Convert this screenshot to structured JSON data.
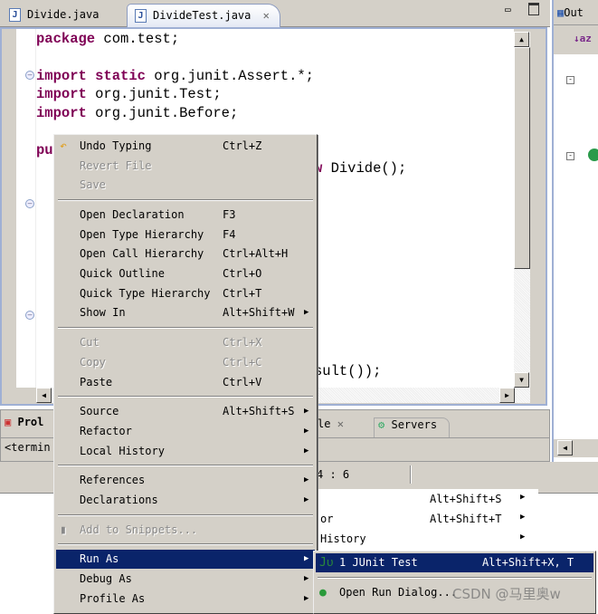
{
  "editor_tabs": [
    {
      "label": "Divide.java",
      "icon": "java-file-icon"
    },
    {
      "label": "DivideTest.java",
      "icon": "java-file-icon",
      "active": true
    }
  ],
  "code_lines": [
    [
      {
        "t": "package",
        "k": 1
      },
      {
        "t": " com.test;"
      }
    ],
    [],
    [
      {
        "t": "import",
        "k": 1
      },
      {
        "t": " "
      },
      {
        "t": "static",
        "k": 1
      },
      {
        "t": " org.junit.Assert.*;"
      }
    ],
    [
      {
        "t": "import",
        "k": 1
      },
      {
        "t": " org.junit.Test;"
      }
    ],
    [
      {
        "t": "import",
        "k": 1
      },
      {
        "t": " org.junit.Before;"
      }
    ],
    [],
    [
      {
        "t": "pu",
        "k": 1
      }
    ],
    [
      {
        "t": "                                 "
      },
      {
        "t": "w",
        "k": 1
      },
      {
        "t": " Divide();"
      }
    ]
  ],
  "code_tail": "sult());",
  "outline_tab": "Out",
  "bottom_tabs": {
    "problems": "Prol",
    "console_frag": "le",
    "servers": "Servers"
  },
  "console_text": "<termin",
  "status_position": "4 : 6",
  "ghost_menu": [
    {
      "label": "",
      "shortcut": "Alt+Shift+S"
    },
    {
      "label": "or",
      "shortcut": "Alt+Shift+T"
    },
    {
      "label": "History",
      "shortcut": ""
    }
  ],
  "context_menu": [
    {
      "label": "Undo Typing",
      "shortcut": "Ctrl+Z",
      "icon": "undo-icon"
    },
    {
      "label": "Revert File",
      "disabled": true
    },
    {
      "label": "Save",
      "disabled": true
    },
    {
      "sep": true
    },
    {
      "label": "Open Declaration",
      "shortcut": "F3"
    },
    {
      "label": "Open Type Hierarchy",
      "shortcut": "F4"
    },
    {
      "label": "Open Call Hierarchy",
      "shortcut": "Ctrl+Alt+H"
    },
    {
      "label": "Quick Outline",
      "shortcut": "Ctrl+O"
    },
    {
      "label": "Quick Type Hierarchy",
      "shortcut": "Ctrl+T"
    },
    {
      "label": "Show In",
      "shortcut": "Alt+Shift+W",
      "submenu": true
    },
    {
      "sep": true
    },
    {
      "label": "Cut",
      "shortcut": "Ctrl+X",
      "disabled": true
    },
    {
      "label": "Copy",
      "shortcut": "Ctrl+C",
      "disabled": true
    },
    {
      "label": "Paste",
      "shortcut": "Ctrl+V"
    },
    {
      "sep": true
    },
    {
      "label": "Source",
      "shortcut": "Alt+Shift+S",
      "submenu": true
    },
    {
      "label": "Refactor",
      "submenu": true
    },
    {
      "label": "Local History",
      "submenu": true
    },
    {
      "sep": true
    },
    {
      "label": "References",
      "submenu": true
    },
    {
      "label": "Declarations",
      "submenu": true
    },
    {
      "sep": true
    },
    {
      "label": "Add to Snippets...",
      "disabled": true,
      "icon": "snippet-icon"
    },
    {
      "sep": true
    },
    {
      "label": "Run As",
      "submenu": true,
      "highlighted": true
    },
    {
      "label": "Debug As",
      "submenu": true
    },
    {
      "label": "Profile As",
      "submenu": true
    }
  ],
  "run_as_submenu": [
    {
      "label": "1 JUnit Test",
      "shortcut": "Alt+Shift+X, T",
      "icon": "junit-icon",
      "highlighted": true
    },
    {
      "sep": true
    },
    {
      "label": "Open Run Dialog...",
      "icon": "run-icon"
    }
  ],
  "watermark": "CSDN @马里奥w",
  "colors": {
    "keyword": "#7f0055",
    "highlight": "#0a246a",
    "chrome": "#d4d0c8"
  }
}
